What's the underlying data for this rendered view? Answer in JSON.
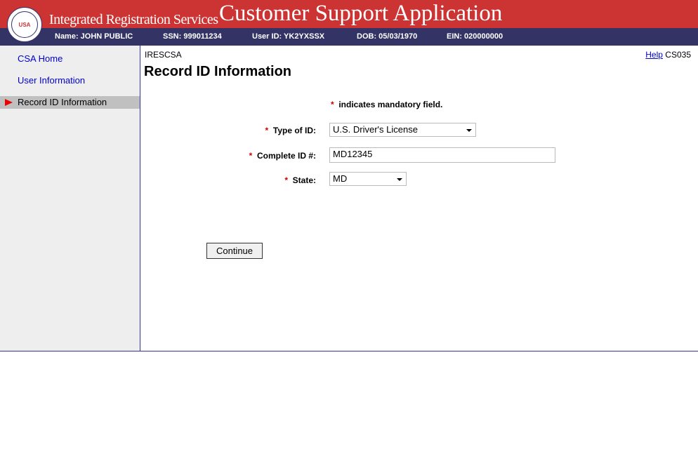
{
  "header": {
    "org": "Integrated Registration Services",
    "app_title": "Customer Support Application",
    "seal_text": "SOCIAL SECURITY ADMINISTRATION USA",
    "colors": {
      "header": "#cc3333",
      "bar": "#333366"
    }
  },
  "user_bar": {
    "name": "Name: JOHN PUBLIC",
    "ssn": "SSN: 999011234",
    "user_id": "User ID: YK2YXSSX",
    "dob": "DOB: 05/03/1970",
    "ein": "EIN: 020000000"
  },
  "sidebar": {
    "items": [
      {
        "label": "CSA Home"
      },
      {
        "label": "User Information"
      },
      {
        "label": "Record ID Information",
        "current": true
      }
    ]
  },
  "main": {
    "app_code": "IRESCSA",
    "help": "Help",
    "screen_code": "CS035",
    "title": "Record ID Information",
    "mandatory_note": "indicates mandatory field.",
    "asterisk": "*",
    "fields": {
      "type_of_id": {
        "label": "Type of ID:",
        "value": "U.S. Driver's License"
      },
      "complete_id": {
        "label": "Complete ID #:",
        "value": "MD12345"
      },
      "state": {
        "label": "State:",
        "value": "MD"
      }
    },
    "continue": "Continue"
  }
}
